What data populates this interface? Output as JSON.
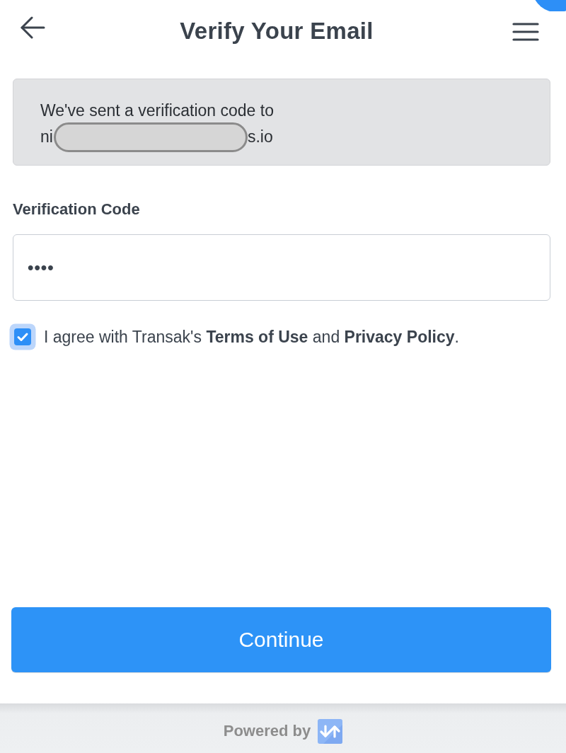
{
  "header": {
    "title": "Verify Your Email"
  },
  "notice": {
    "message": "We've sent a verification code to",
    "email_start": "ni",
    "email_redacted": true,
    "email_end": "s.io"
  },
  "code_field": {
    "label": "Verification Code",
    "value": "••••"
  },
  "agreement": {
    "checked": true,
    "parts": [
      {
        "kind": "text",
        "text": "I agree with Transak's "
      },
      {
        "kind": "link",
        "text": "Terms of Use"
      },
      {
        "kind": "text",
        "text": " and "
      },
      {
        "kind": "link",
        "text": "Privacy Policy"
      },
      {
        "kind": "text",
        "text": "."
      }
    ]
  },
  "continue_button": {
    "label": "Continue"
  },
  "footer": {
    "text": "Powered by"
  }
}
